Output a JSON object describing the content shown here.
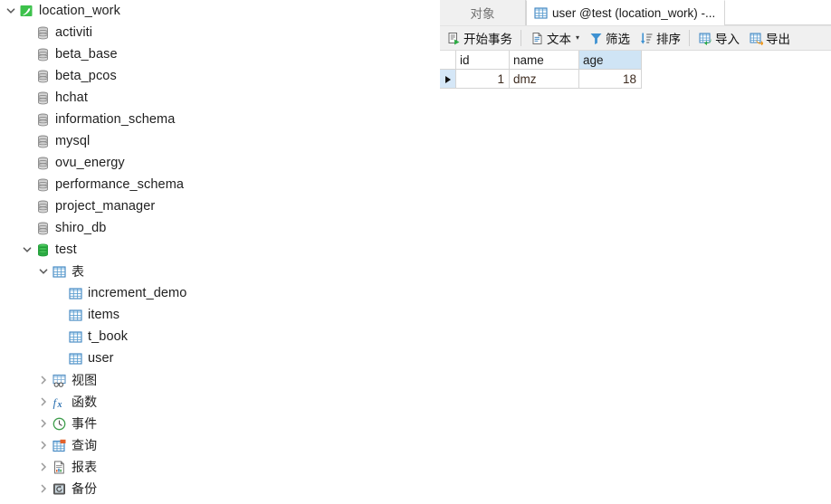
{
  "tree": {
    "nodes": [
      {
        "label": "location_work",
        "icon": "mysql-connection-icon",
        "indent": 0,
        "twisty": "down",
        "type": "connection"
      },
      {
        "label": "activiti",
        "icon": "database-icon",
        "indent": 1,
        "twisty": "none",
        "type": "database"
      },
      {
        "label": "beta_base",
        "icon": "database-icon",
        "indent": 1,
        "twisty": "none",
        "type": "database"
      },
      {
        "label": "beta_pcos",
        "icon": "database-icon",
        "indent": 1,
        "twisty": "none",
        "type": "database"
      },
      {
        "label": "hchat",
        "icon": "database-icon",
        "indent": 1,
        "twisty": "none",
        "type": "database"
      },
      {
        "label": "information_schema",
        "icon": "database-icon",
        "indent": 1,
        "twisty": "none",
        "type": "database"
      },
      {
        "label": "mysql",
        "icon": "database-icon",
        "indent": 1,
        "twisty": "none",
        "type": "database"
      },
      {
        "label": "ovu_energy",
        "icon": "database-icon",
        "indent": 1,
        "twisty": "none",
        "type": "database"
      },
      {
        "label": "performance_schema",
        "icon": "database-icon",
        "indent": 1,
        "twisty": "none",
        "type": "database"
      },
      {
        "label": "project_manager",
        "icon": "database-icon",
        "indent": 1,
        "twisty": "none",
        "type": "database"
      },
      {
        "label": "shiro_db",
        "icon": "database-icon",
        "indent": 1,
        "twisty": "none",
        "type": "database"
      },
      {
        "label": "test",
        "icon": "database-open-icon",
        "indent": 1,
        "twisty": "down",
        "type": "database-open"
      },
      {
        "label": "表",
        "icon": "tables-folder-icon",
        "indent": 2,
        "twisty": "down",
        "type": "folder-tables",
        "cjk": true
      },
      {
        "label": "increment_demo",
        "icon": "table-icon",
        "indent": 3,
        "twisty": "none",
        "type": "table"
      },
      {
        "label": "items",
        "icon": "table-icon",
        "indent": 3,
        "twisty": "none",
        "type": "table"
      },
      {
        "label": "t_book",
        "icon": "table-icon",
        "indent": 3,
        "twisty": "none",
        "type": "table"
      },
      {
        "label": "user",
        "icon": "table-icon",
        "indent": 3,
        "twisty": "none",
        "type": "table"
      },
      {
        "label": "视图",
        "icon": "views-icon",
        "indent": 2,
        "twisty": "right",
        "type": "folder-views",
        "cjk": true
      },
      {
        "label": "函数",
        "icon": "functions-icon",
        "indent": 2,
        "twisty": "right",
        "type": "folder-functions",
        "cjk": true
      },
      {
        "label": "事件",
        "icon": "events-icon",
        "indent": 2,
        "twisty": "right",
        "type": "folder-events",
        "cjk": true
      },
      {
        "label": "查询",
        "icon": "queries-icon",
        "indent": 2,
        "twisty": "right",
        "type": "folder-queries",
        "cjk": true
      },
      {
        "label": "报表",
        "icon": "reports-icon",
        "indent": 2,
        "twisty": "right",
        "type": "folder-reports",
        "cjk": true
      },
      {
        "label": "备份",
        "icon": "backup-icon",
        "indent": 2,
        "twisty": "right",
        "type": "folder-backup",
        "cjk": true
      }
    ]
  },
  "tabs": {
    "objects_tab_label": "对象",
    "active_tab_label": "user @test (location_work) -...",
    "active_tab_icon": "table-icon"
  },
  "toolbar": {
    "begin_transaction": {
      "label": "开始事务",
      "icon": "begin-transaction-icon"
    },
    "text": {
      "label": "文本",
      "icon": "text-icon",
      "caret": "▾"
    },
    "filter": {
      "label": "筛选",
      "icon": "filter-icon"
    },
    "sort": {
      "label": "排序",
      "icon": "sort-icon"
    },
    "import": {
      "label": "导入",
      "icon": "import-icon"
    },
    "export": {
      "label": "导出",
      "icon": "export-icon"
    }
  },
  "grid": {
    "columns": [
      "id",
      "name",
      "age"
    ],
    "selected_column": "age",
    "rows": [
      {
        "indicator": "▶",
        "id": "1",
        "name": "dmz",
        "age": "18"
      }
    ]
  },
  "colors": {
    "accent_blue": "#2f7fc0",
    "selection_blue": "#cfe4f5",
    "row_header_blue": "#d5e7f7",
    "toolbar_bg": "#f0f0f0",
    "db_gray": "#8a8a8a",
    "db_green": "#2eac46"
  }
}
